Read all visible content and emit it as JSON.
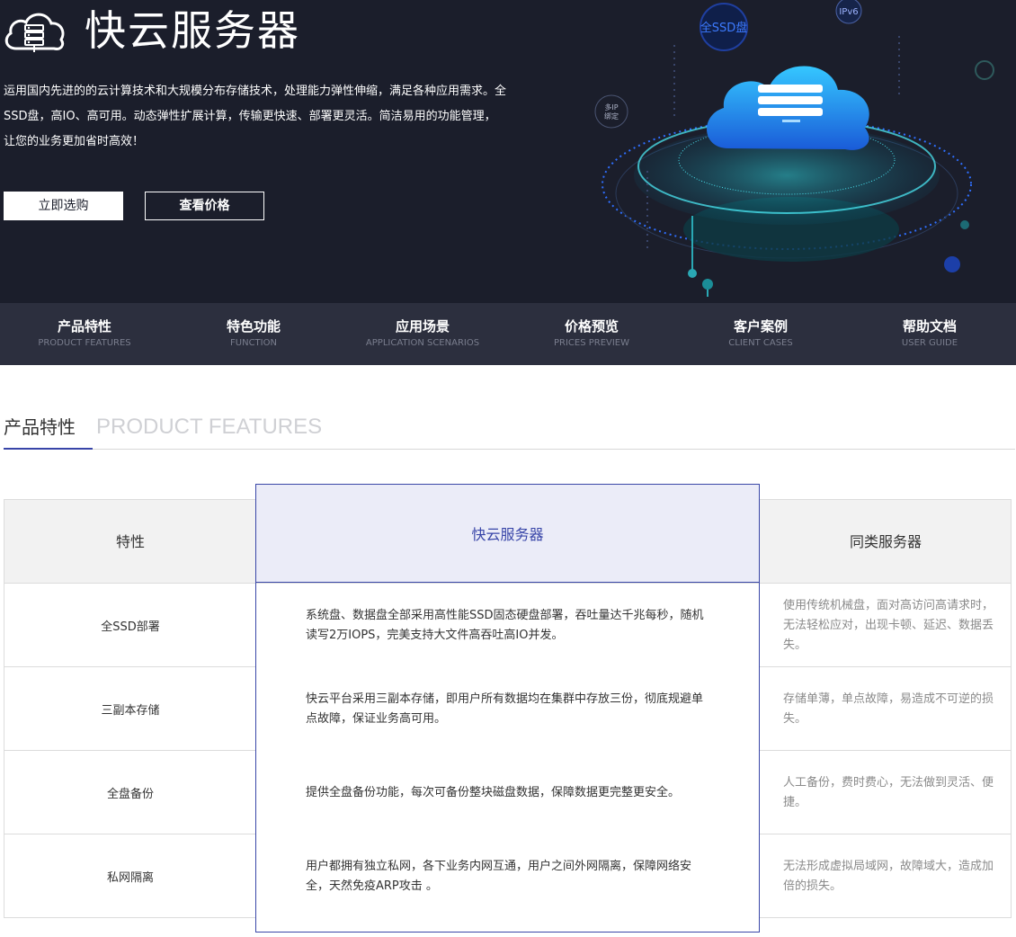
{
  "hero": {
    "title": "快云服务器",
    "description": "运用国内先进的的云计算技术和大规模分布存储技术，处理能力弹性伸缩，满足各种应用需求。全SSD盘，高IO、高可用。动态弹性扩展计算，传输更快速、部署更灵活。简洁易用的功能管理，让您的业务更加省时高效！",
    "buy_button": "立即选购",
    "price_button": "查看价格",
    "art_labels": {
      "ssd": "全SSD盘",
      "ipv6": "IPv6",
      "multi_ip": "多IP",
      "multi_ip2": "绑定"
    }
  },
  "subnav": [
    {
      "cn": "产品特性",
      "en": "PRODUCT FEATURES"
    },
    {
      "cn": "特色功能",
      "en": "FUNCTION"
    },
    {
      "cn": "应用场景",
      "en": "APPLICATION SCENARIOS"
    },
    {
      "cn": "价格预览",
      "en": "PRICES PREVIEW"
    },
    {
      "cn": "客户案例",
      "en": "CLIENT CASES"
    },
    {
      "cn": "帮助文档",
      "en": "USER GUIDE"
    }
  ],
  "section": {
    "cn": "产品特性",
    "en": "PRODUCT FEATURES"
  },
  "table": {
    "headers": {
      "feature": "特性",
      "ours": "快云服务器",
      "others": "同类服务器"
    },
    "rows": [
      {
        "feature": "全SSD部署",
        "ours": "系统盘、数据盘全部采用高性能SSD固态硬盘部署，吞吐量达千兆每秒，随机读写2万IOPS，完美支持大文件高吞吐高IO并发。",
        "others": "使用传统机械盘，面对高访问高请求时，无法轻松应对，出现卡顿、延迟、数据丢失。"
      },
      {
        "feature": "三副本存储",
        "ours": "快云平台采用三副本存储，即用户所有数据均在集群中存放三份，彻底规避单点故障，保证业务高可用。",
        "others": "存储单薄，单点故障，易造成不可逆的损失。"
      },
      {
        "feature": "全盘备份",
        "ours": "提供全盘备份功能，每次可备份整块磁盘数据，保障数据更完整更安全。",
        "others": "人工备份，费时费心，无法做到灵活、便捷。"
      },
      {
        "feature": "私网隔离",
        "ours": "用户都拥有独立私网，各下业务内网互通，用户之间外网隔离，保障网络安全，天然免疫ARP攻击 。",
        "others": "无法形成虚拟局域网，故障域大，造成加倍的损失。"
      }
    ]
  },
  "colors": {
    "hero_bg": "#1b1e2b",
    "nav_bg": "#2c2f3e",
    "accent": "#3845a8",
    "highlight_bg": "#ebecf8"
  }
}
